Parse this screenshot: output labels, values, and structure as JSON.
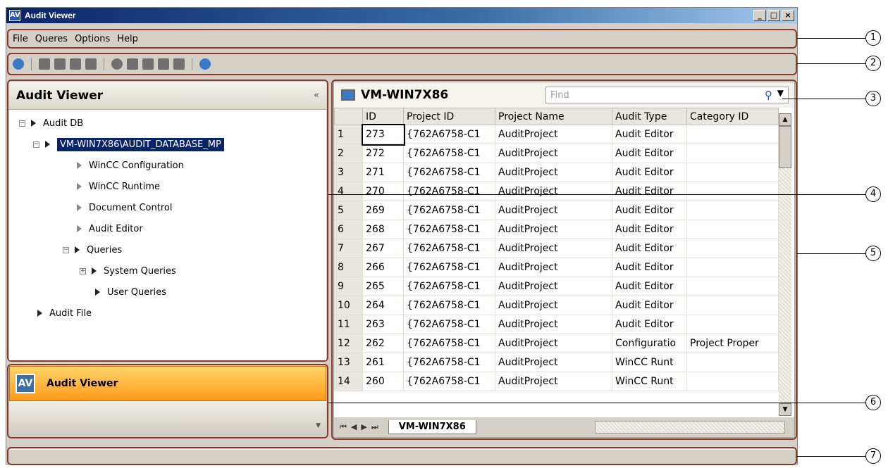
{
  "window": {
    "title": "Audit Viewer",
    "minimize": "_",
    "maximize": "□",
    "close": "×"
  },
  "menu": [
    "File",
    "Queres",
    "Options",
    "Help"
  ],
  "left": {
    "header": "Audit Viewer",
    "collapse": "«",
    "tree": [
      {
        "label": "Audit DB",
        "level": 0
      },
      {
        "label": "VM-WIN7X86\\AUDIT_DATABASE_MP",
        "level": 1
      },
      {
        "label": "WinCC Configuration",
        "level": 2
      },
      {
        "label": "WinCC Runtime",
        "level": 2
      },
      {
        "label": "Document Control",
        "level": 2
      },
      {
        "label": "Audit Editor",
        "level": 2
      },
      {
        "label": "Queries",
        "level": 2
      },
      {
        "label": "System Queries",
        "level": 3
      },
      {
        "label": "User Queries",
        "level": 3
      },
      {
        "label": "Audit File",
        "level": 0
      }
    ]
  },
  "nav": {
    "label": "Audit Viewer"
  },
  "right": {
    "title": "VM-WIN7X86",
    "find_placeholder": "Find",
    "columns": [
      "ID",
      "Project ID",
      "Project Name",
      "Audit Type",
      "Category ID"
    ],
    "rows": [
      [
        "1",
        "273",
        "{762A6758-C1",
        "AuditProject",
        "Audit Editor",
        ""
      ],
      [
        "2",
        "272",
        "{762A6758-C1",
        "AuditProject",
        "Audit Editor",
        ""
      ],
      [
        "3",
        "271",
        "{762A6758-C1",
        "AuditProject",
        "Audit Editor",
        ""
      ],
      [
        "4",
        "270",
        "{762A6758-C1",
        "AuditProject",
        "Audit Editor",
        ""
      ],
      [
        "5",
        "269",
        "{762A6758-C1",
        "AuditProject",
        "Audit Editor",
        ""
      ],
      [
        "6",
        "268",
        "{762A6758-C1",
        "AuditProject",
        "Audit Editor",
        ""
      ],
      [
        "7",
        "267",
        "{762A6758-C1",
        "AuditProject",
        "Audit Editor",
        ""
      ],
      [
        "8",
        "266",
        "{762A6758-C1",
        "AuditProject",
        "Audit Editor",
        ""
      ],
      [
        "9",
        "265",
        "{762A6758-C1",
        "AuditProject",
        "Audit Editor",
        ""
      ],
      [
        "10",
        "264",
        "{762A6758-C1",
        "AuditProject",
        "Audit Editor",
        ""
      ],
      [
        "11",
        "263",
        "{762A6758-C1",
        "AuditProject",
        "Audit Editor",
        ""
      ],
      [
        "12",
        "262",
        "{762A6758-C1",
        "AuditProject",
        "Configuratio",
        "Project Proper"
      ],
      [
        "13",
        "261",
        "{762A6758-C1",
        "AuditProject",
        "WinCC Runt",
        ""
      ],
      [
        "14",
        "260",
        "{762A6758-C1",
        "AuditProject",
        "WinCC Runt",
        ""
      ]
    ],
    "sheet_tab": "VM-WIN7X86",
    "tab_nav": "⏮◀▶⏭"
  },
  "callouts": [
    "1",
    "2",
    "3",
    "4",
    "5",
    "6",
    "7"
  ]
}
